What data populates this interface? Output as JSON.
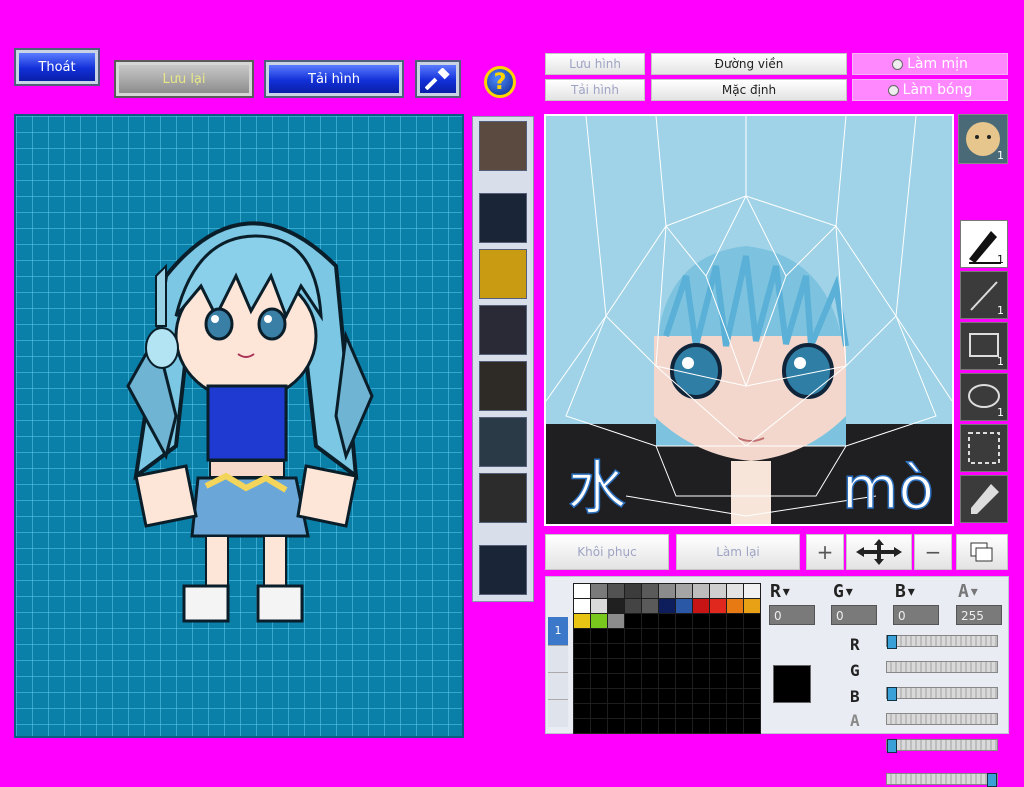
{
  "toolbar": {
    "exit_label": "Thoát",
    "save_label": "Lưu lại",
    "reload_label": "Tải hình",
    "help_icon": "?"
  },
  "face_toolbar": {
    "save_image": "Lưu hình",
    "load_image": "Tải hình",
    "outline": "Đường viền",
    "default": "Mặc định",
    "smooth": "Làm mịn",
    "shading": "Làm bóng"
  },
  "face_editor": {
    "left_glyph": "水",
    "right_text": "mò"
  },
  "bottom_actions": {
    "restore": "Khôi phục",
    "redo": "Làm lại"
  },
  "tools": [
    {
      "name": "pen-icon",
      "count": "1"
    },
    {
      "name": "line-icon",
      "count": "1"
    },
    {
      "name": "rectangle-icon",
      "count": "1"
    },
    {
      "name": "ellipse-icon",
      "count": "1"
    },
    {
      "name": "selection-icon",
      "count": ""
    },
    {
      "name": "eyedropper-icon",
      "count": ""
    }
  ],
  "palette_tab": "1",
  "palette_colors": [
    "#ffffff",
    "#7a7a7a",
    "#525252",
    "#3c3c3c",
    "#5a5a5a",
    "#8c8c8c",
    "#a5a5a5",
    "#bdbdbd",
    "#cfcfcf",
    "#e3e3e3",
    "#f2f2f2",
    "#ffffff",
    "#dadada",
    "#202020",
    "#444444",
    "#5a5a5a",
    "#0e1e5c",
    "#2b58a6",
    "#c81414",
    "#e0281e",
    "#e87a14",
    "#e8a014",
    "#e8c414",
    "#78c81e",
    "#8c8c8c"
  ],
  "rgba": {
    "labels": [
      "R",
      "G",
      "B",
      "A"
    ],
    "values": [
      "0",
      "0",
      "0",
      "255"
    ]
  },
  "current_color": "#000000",
  "preview_badge": "1",
  "colors": {
    "background": "#ff00ff",
    "accent": "#1230d8"
  }
}
